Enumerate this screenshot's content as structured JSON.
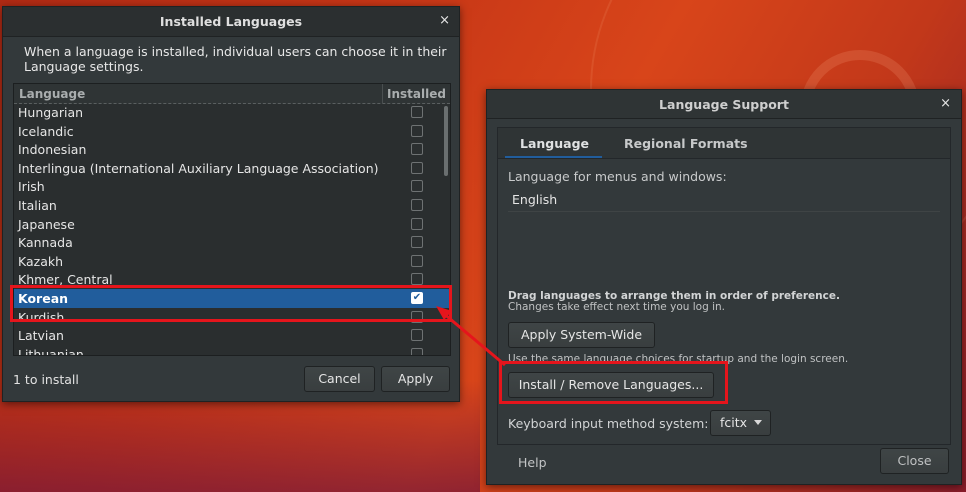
{
  "installed_dialog": {
    "title": "Installed Languages",
    "intro": "When a language is installed, individual users can choose it in their Language settings.",
    "columns": {
      "language": "Language",
      "installed": "Installed"
    },
    "rows": [
      {
        "name": "Hungarian",
        "installed": false,
        "selected": false
      },
      {
        "name": "Icelandic",
        "installed": false,
        "selected": false
      },
      {
        "name": "Indonesian",
        "installed": false,
        "selected": false
      },
      {
        "name": "Interlingua (International Auxiliary Language Association)",
        "installed": false,
        "selected": false
      },
      {
        "name": "Irish",
        "installed": false,
        "selected": false
      },
      {
        "name": "Italian",
        "installed": false,
        "selected": false
      },
      {
        "name": "Japanese",
        "installed": false,
        "selected": false
      },
      {
        "name": "Kannada",
        "installed": false,
        "selected": false
      },
      {
        "name": "Kazakh",
        "installed": false,
        "selected": false
      },
      {
        "name": "Khmer, Central",
        "installed": false,
        "selected": false
      },
      {
        "name": "Korean",
        "installed": true,
        "selected": true
      },
      {
        "name": "Kurdish",
        "installed": false,
        "selected": false
      },
      {
        "name": "Latvian",
        "installed": false,
        "selected": false
      },
      {
        "name": "Lithuanian",
        "installed": false,
        "selected": false
      }
    ],
    "status": "1 to install",
    "cancel_label": "Cancel",
    "apply_label": "Apply",
    "close_glyph": "×"
  },
  "support_dialog": {
    "title": "Language Support",
    "close_glyph": "×",
    "tabs": [
      "Language",
      "Regional Formats"
    ],
    "menus_label": "Language for menus and windows:",
    "current_language": "English",
    "drag_hint": "Drag languages to arrange them in order of preference.",
    "drag_sub": "Changes take effect next time you log in.",
    "apply_system_label": "Apply System-Wide",
    "same_hint": "Use the same language choices for startup and the login screen.",
    "install_remove_label": "Install / Remove Languages...",
    "keyboard_label": "Keyboard input method system:",
    "keyboard_value": "fcitx",
    "help_label": "Help",
    "close_label": "Close"
  },
  "annotation_color": "#e5151c"
}
